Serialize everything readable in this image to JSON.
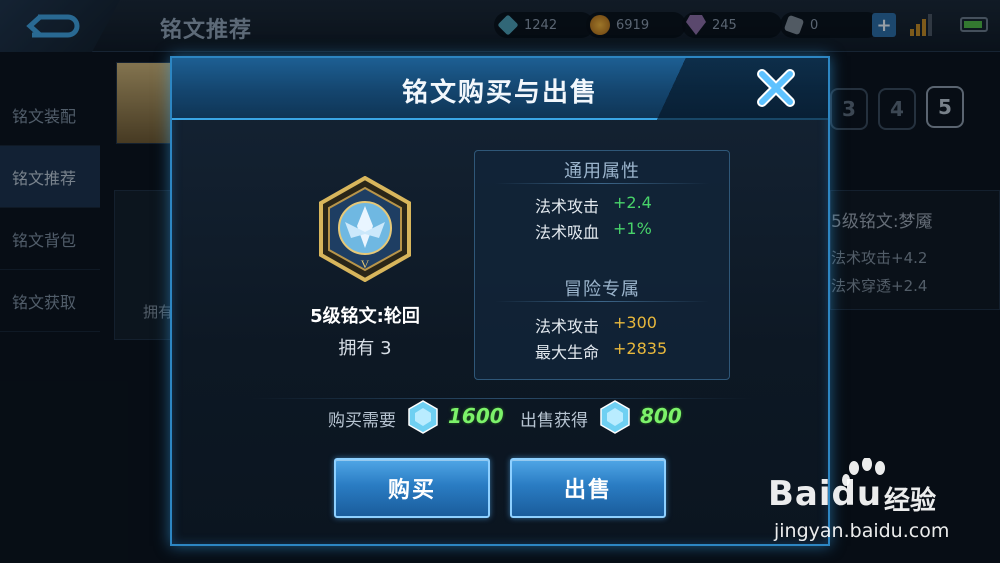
{
  "header": {
    "title": "铭文推荐",
    "resources": [
      {
        "icon": "crystal-icon",
        "value": "1242"
      },
      {
        "icon": "gold-coin-icon",
        "value": "6919"
      },
      {
        "icon": "diamond-icon",
        "value": "245"
      },
      {
        "icon": "token-icon",
        "value": "0"
      }
    ]
  },
  "sidebar": {
    "items": [
      {
        "label": "铭文装配"
      },
      {
        "label": "铭文推荐"
      },
      {
        "label": "铭文背包"
      },
      {
        "label": "铭文获取"
      }
    ]
  },
  "background": {
    "level_tabs": [
      "3",
      "4",
      "5"
    ],
    "left_card_text": "拥有",
    "right_title": "5级铭文:梦魇",
    "right_attrs": [
      "法术攻击+4.2",
      "法术穿透+2.4"
    ]
  },
  "modal": {
    "title": "铭文购买与出售",
    "item_name": "5级铭文:轮回",
    "owned": "拥有 3",
    "general": {
      "title": "通用属性",
      "attrs": [
        {
          "name": "法术攻击",
          "value": "+2.4"
        },
        {
          "name": "法术吸血",
          "value": "+1%"
        }
      ]
    },
    "adventure": {
      "title": "冒险专属",
      "attrs": [
        {
          "name": "法术攻击",
          "value": "+300"
        },
        {
          "name": "最大生命",
          "value": "+2835"
        }
      ]
    },
    "buy_cost_label": "购买需要",
    "buy_cost": "1600",
    "sell_gain_label": "出售获得",
    "sell_gain": "800",
    "buy_button": "购买",
    "sell_button": "出售"
  },
  "watermark": {
    "logo_text": "Baidu",
    "logo_cn": "经验",
    "url": "jingyan.baidu.com"
  },
  "colors": {
    "accent": "#2d86c2",
    "attr_general": "#48d36a",
    "attr_adventure": "#e8b83c",
    "price": "#7cf26a"
  }
}
